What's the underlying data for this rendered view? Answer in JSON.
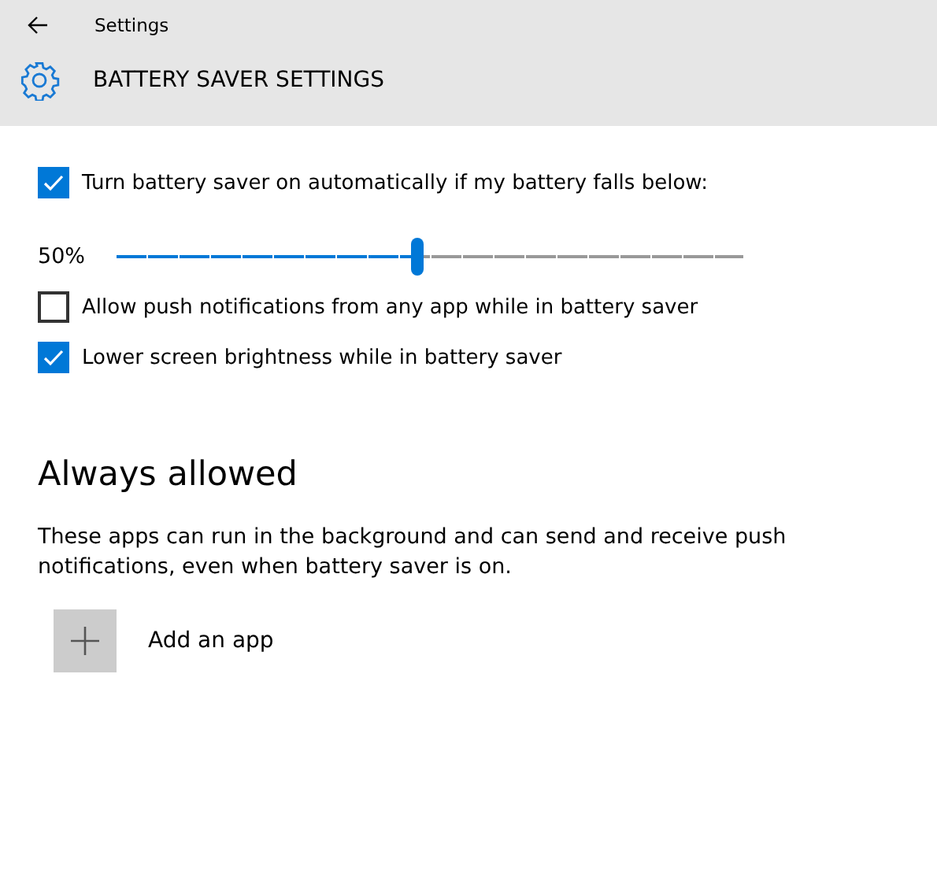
{
  "window": {
    "title": "Settings"
  },
  "page": {
    "title": "BATTERY SAVER SETTINGS"
  },
  "auto_saver": {
    "label": "Turn battery saver on automatically if my battery falls below:",
    "checked": true
  },
  "threshold": {
    "reading": "50%",
    "level": 0.48
  },
  "options": [
    {
      "label": "Allow push notifications from any app while in battery saver",
      "checked": false
    },
    {
      "label": "Lower screen brightness while in battery saver",
      "checked": true
    }
  ],
  "always_allowed": {
    "heading": "Always allowed",
    "description": "These apps can run in the background and can send and receive push notifications, even when battery saver is on.",
    "add_label": "Add an app"
  }
}
